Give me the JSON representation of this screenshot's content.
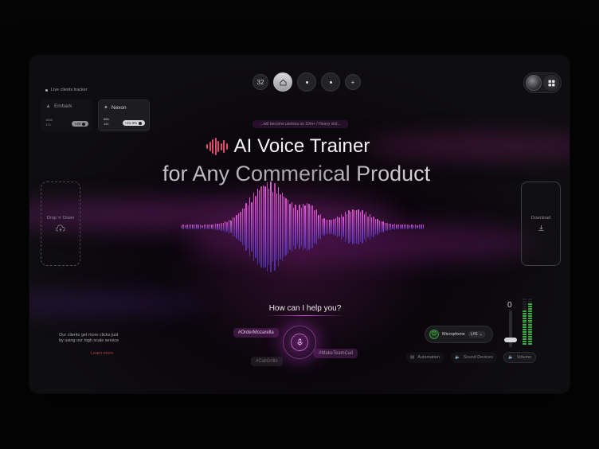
{
  "nav": {
    "count": "32",
    "icons": [
      "home-icon",
      "dot-icon",
      "dot-icon",
      "plus-icon"
    ]
  },
  "tracker": {
    "label": "Live clients tracker",
    "cards": [
      {
        "name": "Embark",
        "badge": "+48",
        "stat1": "1843",
        "stat2": "174"
      },
      {
        "name": "Nexon",
        "badge": "+21.3%",
        "stat1": "888",
        "stat2": "161"
      }
    ]
  },
  "hero": {
    "tagline": "...will become useless on 10m+ / Heavy slot...",
    "title_line1": "AI Voice Trainer",
    "title_line2": "for Any Commerical Product"
  },
  "dropzone": {
    "label": "Drop 'n' Down"
  },
  "download": {
    "label": "Download"
  },
  "assistant": {
    "prompt": "How can I help you?",
    "tags": [
      "#OrderMozarella",
      "#CallGrillo",
      "#MakeTeamCall"
    ]
  },
  "footnote": {
    "text": "Our clients get more clicks just by using our high scale service",
    "link": "Learn more"
  },
  "controls": {
    "microphone_label": "Microphone",
    "microphone_select": "LH1",
    "automation": "Automation",
    "sound_devices": "Sound Devices",
    "volume": "Volume",
    "slider_value": "0",
    "slider_level": 0.15
  },
  "colors": {
    "accent_magenta": "#c85fd4",
    "accent_red": "#e0476e",
    "power_green": "#5ee063",
    "meter_green": "#36b23c"
  }
}
